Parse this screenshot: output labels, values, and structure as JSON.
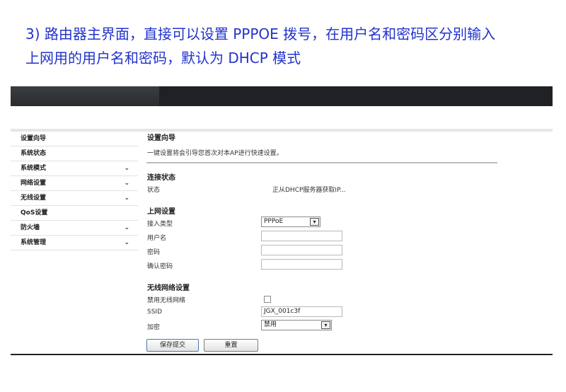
{
  "caption": {
    "line1": "3) 路由器主界面，直接可以设置 PPPOE 拨号，在用户名和密码区分别输入",
    "line2": "上网用的用户名和密码，默认为 DHCP 模式"
  },
  "sidebar": {
    "items": [
      {
        "label": "设置向导",
        "has_chevron": false
      },
      {
        "label": "系统状态",
        "has_chevron": false
      },
      {
        "label": "系统模式",
        "has_chevron": true
      },
      {
        "label": "网络设置",
        "has_chevron": true
      },
      {
        "label": "无线设置",
        "has_chevron": true
      },
      {
        "label": "QoS设置",
        "has_chevron": false
      },
      {
        "label": "防火墙",
        "has_chevron": true
      },
      {
        "label": "系统管理",
        "has_chevron": true
      }
    ],
    "chevron_glyph": "⌄"
  },
  "wizard": {
    "title": "设置向导",
    "description": "一键设置将会引导您首次对本AP进行快速设置。"
  },
  "connection": {
    "title": "连接状态",
    "status_label": "状态",
    "status_value": "正从DHCP服务器获取IP..."
  },
  "internet": {
    "title": "上网设置",
    "access_type_label": "接入类型",
    "access_type_value": "PPPoE",
    "username_label": "用户名",
    "username_value": "",
    "password_label": "密码",
    "password_value": "",
    "confirm_password_label": "确认密码",
    "confirm_password_value": ""
  },
  "wireless": {
    "title": "无线网络设置",
    "disable_label": "禁用无线网络",
    "disable_checked": false,
    "ssid_label": "SSID",
    "ssid_value": "JGX_001c3f",
    "encryption_label": "加密",
    "encryption_value": "禁用"
  },
  "buttons": {
    "save": "保存提交",
    "reset": "重置"
  },
  "colors": {
    "caption": "#2233cc",
    "topbar": "#1f2124",
    "divider": "#bdbdbd"
  }
}
